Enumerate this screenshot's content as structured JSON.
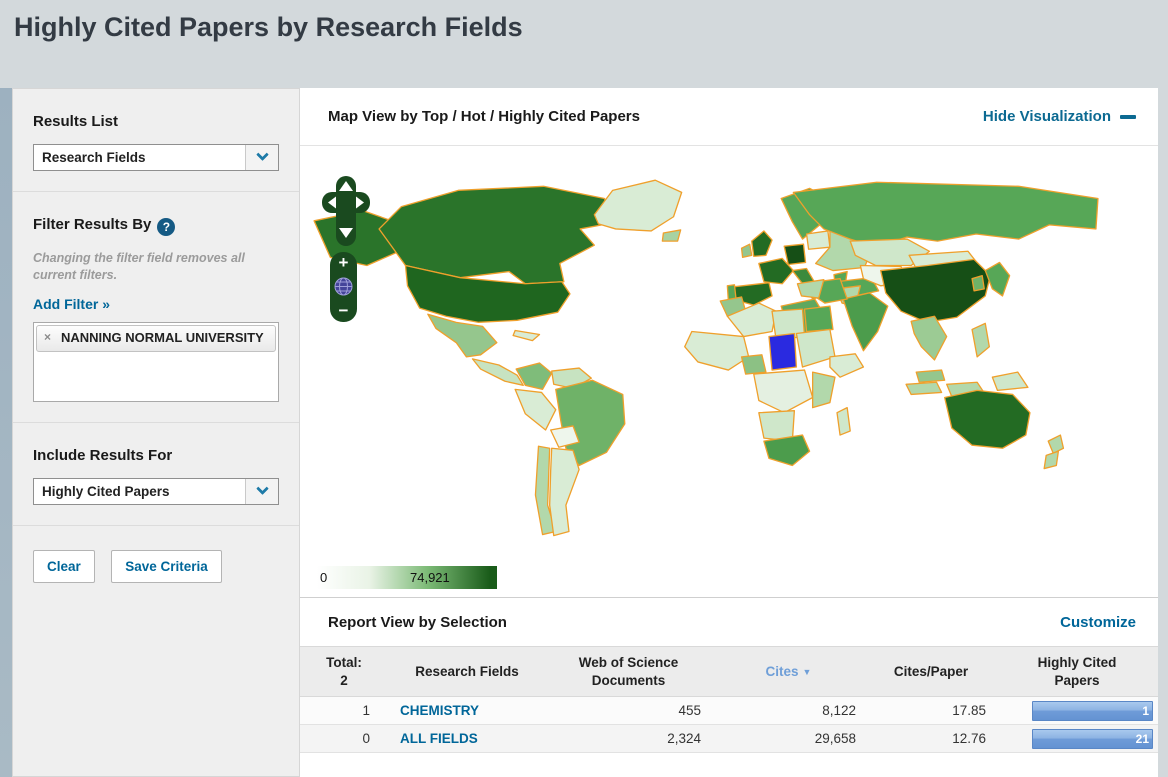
{
  "page": {
    "title": "Highly Cited Papers by Research Fields"
  },
  "sidebar": {
    "results_list_label": "Results List",
    "results_list_value": "Research Fields",
    "filter_label": "Filter Results By",
    "help_symbol": "?",
    "filter_note": "Changing the filter field removes all current filters.",
    "add_filter_label": "Add Filter »",
    "filter_tag": {
      "remove_symbol": "×",
      "label": "NANNING NORMAL UNIVERSITY"
    },
    "include_label": "Include Results For",
    "include_value": "Highly Cited Papers",
    "clear_button": "Clear",
    "save_button": "Save Criteria"
  },
  "map_section": {
    "title": "Map View by Top / Hot / Highly Cited Papers",
    "hide_link": "Hide Visualization",
    "zoom_in": "+",
    "zoom_out": "−",
    "legend": {
      "min": "0",
      "max": "74,921"
    },
    "colors": {
      "border": "#efa02c",
      "selected": "#2a2ae0",
      "scale_min": "#ffffff",
      "scale_max": "#1a5c1a",
      "control": "#1a4a1f"
    },
    "region_colors": {
      "alaska": "#2a742a",
      "canada": "#2a742a",
      "usa": "#1f661f",
      "greenland": "#d9ecd5",
      "iceland": "#a8d2a2",
      "mexico": "#95c68d",
      "central_america": "#c7e3c1",
      "cuba": "#d9ecd5",
      "colombia": "#7fbc7a",
      "venezuela": "#c7e3c1",
      "brazil": "#6fb268",
      "peru": "#d9ecd5",
      "bolivia": "#eef6ec",
      "chile": "#b2d8ab",
      "argentina": "#d9ecd5",
      "uk": "#236b23",
      "ireland": "#95c68d",
      "scandinavia": "#57a757",
      "finland": "#57a757",
      "poland": "#d9ecd5",
      "east_europe": "#b2d8ab",
      "germany": "#164f16",
      "france": "#236b23",
      "spain": "#236b23",
      "portugal": "#57a757",
      "italy": "#3c8a3c",
      "greece": "#57a757",
      "turkey": "#57a757",
      "russia": "#57a757",
      "kazakhstan": "#cfe7ca",
      "central_asia": "#eef6ec",
      "mongolia": "#d9ecd5",
      "china": "#164f16",
      "india": "#4c9c4c",
      "pakistan": "#b2d8ab",
      "iran": "#57a757",
      "iraq_syria": "#b2d8ab",
      "saudi_arabia": "#5fa85f",
      "morocco": "#95c68d",
      "algeria": "#d9ecd5",
      "libya": "#cfe7ca",
      "egypt": "#57a757",
      "west_africa": "#d9ecd5",
      "nigeria": "#8cc184",
      "chad": "#2a2ae0",
      "sudan": "#cfe7ca",
      "ethiopia": "#d9ecd5",
      "central_africa": "#e4f0e1",
      "east_africa": "#b2d8ab",
      "angola_namibia": "#cfe7ca",
      "south_africa": "#4c9c4c",
      "madagascar": "#cfe7ca",
      "indochina": "#9ccb94",
      "malaysia": "#95c68d",
      "indonesia_west": "#b2d8ab",
      "indonesia_east": "#b2d8ab",
      "new_guinea": "#cfe7ca",
      "philippines": "#b2d8ab",
      "japan": "#57a757",
      "south_korea": "#6fb268",
      "australia": "#236b23",
      "new_zealand_north": "#b2d8ab",
      "new_zealand_south": "#b2d8ab"
    }
  },
  "report": {
    "title": "Report View by Selection",
    "customize_link": "Customize",
    "total_label": "Total:",
    "total_value": "2",
    "sort_arrow": "▼",
    "columns": [
      "Research Fields",
      "Web of Science Documents",
      "Cites",
      "Cites/Paper",
      "Highly Cited Papers"
    ],
    "rows": [
      {
        "rank": "1",
        "field": "CHEMISTRY",
        "documents": "455",
        "cites": "8,122",
        "cites_per_paper": "17.85",
        "highly_cited_papers": "1"
      },
      {
        "rank": "0",
        "field": "ALL FIELDS",
        "documents": "2,324",
        "cites": "29,658",
        "cites_per_paper": "12.76",
        "highly_cited_papers": "21"
      }
    ]
  },
  "chart_data": {
    "type": "heatmap",
    "title": "Map View by Top / Hot / Highly Cited Papers",
    "legend_range": [
      0,
      74921
    ],
    "selected_region": "Chad",
    "note": "World choropleth: white (0) to dark green (74,921) highly cited papers per country; Chad highlighted blue as selection."
  }
}
